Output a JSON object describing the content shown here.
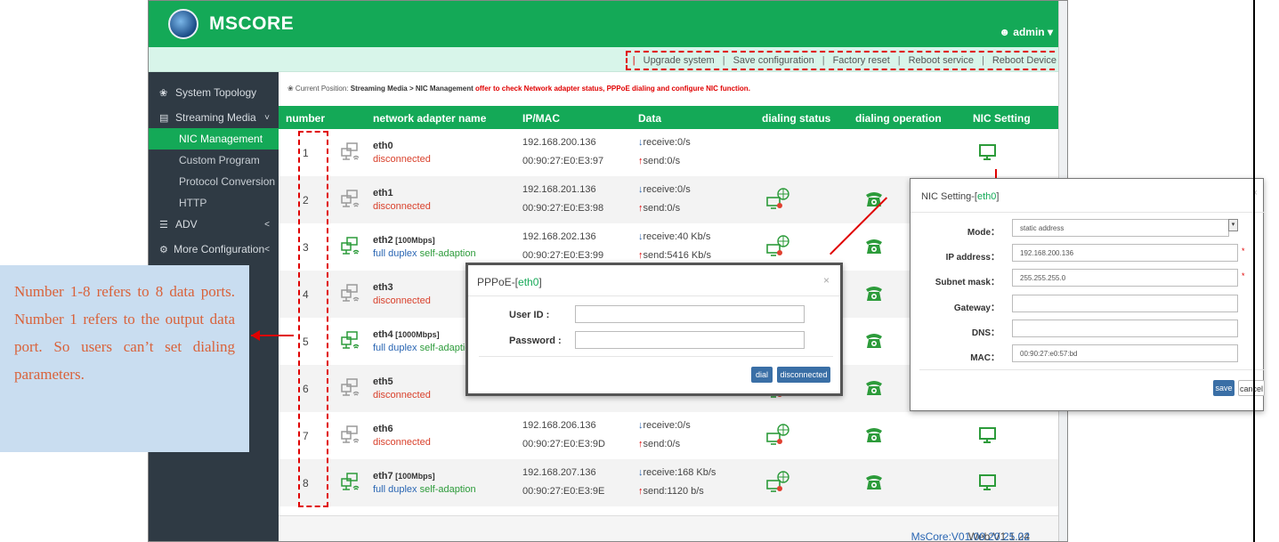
{
  "app": {
    "brand": "MSCORE",
    "user": "admin ▾"
  },
  "menu": [
    "Upgrade system",
    "Save configuration",
    "Factory reset",
    "Reboot service",
    "Reboot Device"
  ],
  "sidebar": [
    {
      "label": "System Topology",
      "icon": "home-icon",
      "glyph": "❀",
      "chev": ""
    },
    {
      "label": "Streaming Media",
      "icon": "film-icon",
      "glyph": "▤",
      "chev": "˅"
    },
    {
      "label": "NIC Management",
      "sub": true,
      "active": true
    },
    {
      "label": "Custom Program",
      "sub": true
    },
    {
      "label": "Protocol Conversion",
      "sub": true
    },
    {
      "label": "HTTP",
      "sub": true
    },
    {
      "label": "ADV",
      "icon": "list-icon",
      "glyph": "☰",
      "chev": "<"
    },
    {
      "label": "More Configuration",
      "icon": "cogs-icon",
      "glyph": "⚙",
      "chev": "<"
    }
  ],
  "breadcrumb": {
    "prefix": "❀ Current Position: ",
    "path": "Streaming Media  > NIC Management",
    "note": " offer to check Network adapter status, PPPoE dialing and configure NIC function."
  },
  "table": {
    "headers": [
      "number",
      "network adapter name",
      "IP/MAC",
      "Data",
      "dialing status",
      "dialing operation",
      "NIC Setting"
    ],
    "rows": [
      {
        "num": "1",
        "name": "eth0",
        "speed": "",
        "duplex": "",
        "status": "disconnected",
        "ip": "192.168.200.136",
        "mac": "00:90:27:E0:E3:97",
        "rx": "receive:0/s",
        "tx": "send:0/s"
      },
      {
        "num": "2",
        "name": "eth1",
        "speed": "",
        "duplex": "",
        "status": "disconnected",
        "ip": "192.168.201.136",
        "mac": "00:90:27:E0:E3:98",
        "rx": "receive:0/s",
        "tx": "send:0/s"
      },
      {
        "num": "3",
        "name": "eth2",
        "speed": " [100Mbps]",
        "duplex": "full duplex ",
        "status": "self-adaption",
        "ip": "192.168.202.136",
        "mac": "00:90:27:E0:E3:99",
        "rx": "receive:40 Kb/s",
        "tx": "send:5416 Kb/s"
      },
      {
        "num": "4",
        "name": "eth3",
        "speed": "",
        "duplex": "",
        "status": "disconnected",
        "ip": "",
        "mac": "",
        "rx": "",
        "tx": ""
      },
      {
        "num": "5",
        "name": "eth4",
        "speed": " [1000Mbps]",
        "duplex": "full duplex ",
        "status": "self-adaption",
        "ip": "",
        "mac": "",
        "rx": "",
        "tx": ""
      },
      {
        "num": "6",
        "name": "eth5",
        "speed": "",
        "duplex": "",
        "status": "disconnected",
        "ip": "",
        "mac": "",
        "rx": "",
        "tx": ""
      },
      {
        "num": "7",
        "name": "eth6",
        "speed": "",
        "duplex": "",
        "status": "disconnected",
        "ip": "192.168.206.136",
        "mac": "00:90:27:E0:E3:9D",
        "rx": "receive:0/s",
        "tx": "send:0/s"
      },
      {
        "num": "8",
        "name": "eth7",
        "speed": " [100Mbps]",
        "duplex": "full duplex ",
        "status": "self-adaption",
        "ip": "192.168.207.136",
        "mac": "00:90:27:E0:E3:9E",
        "rx": "receive:168 Kb/s",
        "tx": "send:1120 b/s"
      }
    ]
  },
  "footer": {
    "web": "Web:V1.1.24 ",
    "core": "MsCore:V01.00.20.25.02"
  },
  "callout": "Number 1-8 refers to 8 data ports. Number 1 refers to the output data port. So users can’t set dialing parameters.",
  "pppoe": {
    "title": "PPPoE-[",
    "nic": "eth0",
    "title_end": "]",
    "close": "×",
    "user_label": "User ID :",
    "pass_label": "Password :",
    "dial": "dial",
    "disconnect": "disconnected"
  },
  "nic_dialog": {
    "title": "NIC Setting-[",
    "nic": "eth0",
    "title_end": "]",
    "close": "×",
    "mode_label": "Mode：",
    "mode_value": "static address",
    "ip_label": "IP address：",
    "ip_value": "192.168.200.136",
    "mask_label": "Subnet mask：",
    "mask_value": "255.255.255.0",
    "gw_label": "Gateway：",
    "gw_value": "",
    "dns_label": "DNS：",
    "dns_value": "",
    "mac_label": "MAC：",
    "mac_value": "00:90:27:e0:57:bd",
    "save": "save",
    "cancel": "cancel"
  },
  "colors": {
    "brand_green": "#14a957",
    "menu_bg": "#d8f5ea",
    "sidebar_bg": "#2f3a44",
    "alert_red": "#e00000"
  }
}
